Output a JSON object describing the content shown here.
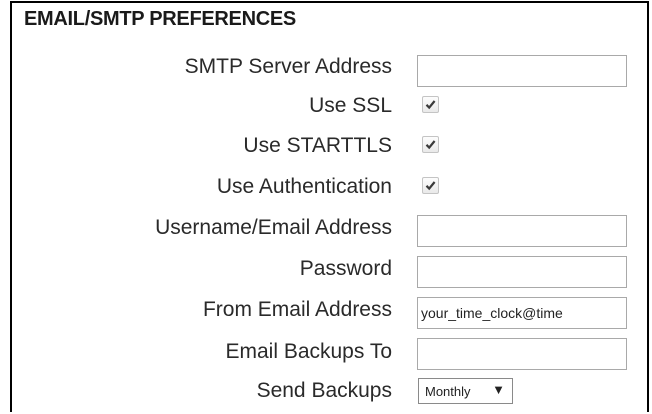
{
  "section": {
    "title": "EMAIL/SMTP PREFERENCES"
  },
  "fields": {
    "smtp_server": {
      "label": "SMTP Server Address",
      "value": ""
    },
    "use_ssl": {
      "label": "Use SSL",
      "checked": true
    },
    "use_starttls": {
      "label": "Use STARTTLS",
      "checked": true
    },
    "use_auth": {
      "label": "Use Authentication",
      "checked": true
    },
    "username": {
      "label": "Username/Email Address",
      "value": ""
    },
    "password": {
      "label": "Password",
      "value": ""
    },
    "from_email": {
      "label": "From Email Address",
      "value": "your_time_clock@time"
    },
    "backups_to": {
      "label": "Email Backups To",
      "value": ""
    },
    "send_backups": {
      "label": "Send Backups",
      "value": "Monthly",
      "arrow": "▼"
    }
  },
  "icons": {
    "checkmark": "checkmark-icon",
    "dropdown": "dropdown-arrow-icon"
  }
}
